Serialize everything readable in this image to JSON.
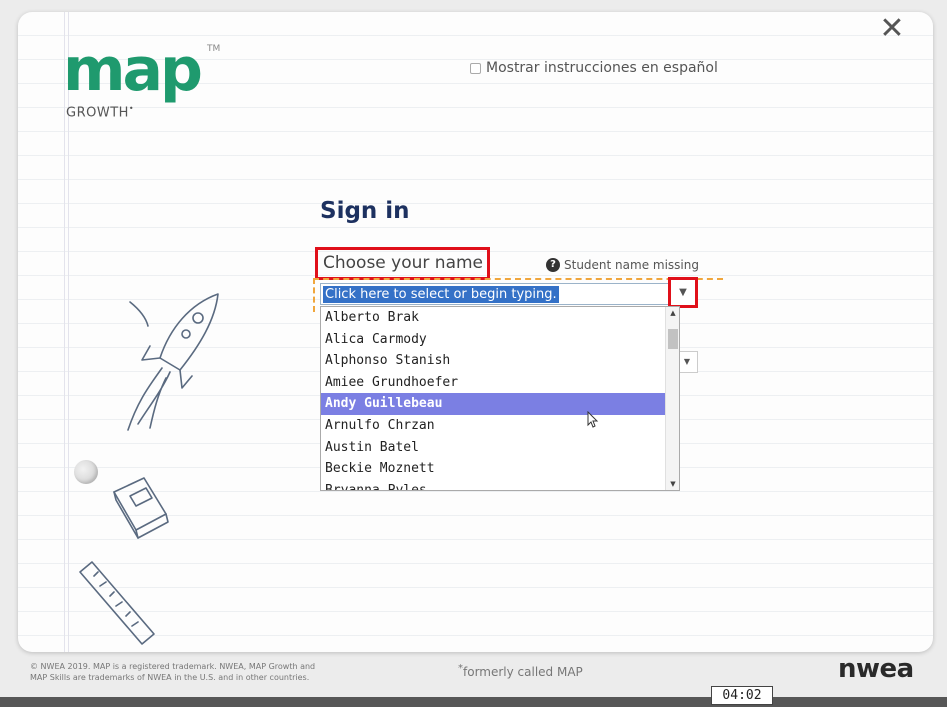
{
  "brand": {
    "logo_text": "map",
    "tm_mark": "TM",
    "logo_subtitle": "GROWTH",
    "logo_subtitle_mark": "•"
  },
  "header": {
    "close_icon": "close-icon",
    "spanish_label": "Mostrar instrucciones en español",
    "spanish_checked": false
  },
  "signin": {
    "title": "Sign in",
    "name_label": "Choose your name",
    "missing_link": "Student name missing",
    "help_icon": "?",
    "combo_value": "Click here to select or begin typing.",
    "dropdown_arrow": "▼"
  },
  "names": [
    "Alberto Brak",
    "Alica Carmody",
    "Alphonso Stanish",
    "Amiee Grundhoefer",
    "Andy Guillebeau",
    "Arnulfo Chrzan",
    "Austin Batel",
    "Beckie Moznett",
    "Bryanna Pyles"
  ],
  "selected_name": "Andy Guillebeau",
  "footer": {
    "legal_line1": "© NWEA 2019. MAP is a registered trademark. NWEA, MAP Growth and",
    "legal_line2": "MAP Skills are trademarks of NWEA in the U.S. and in other countries.",
    "formerly_mark": "*",
    "formerly": "formerly called MAP",
    "nwea_logo": "nwea"
  },
  "timer": "04:02",
  "colors": {
    "title": "#1d3160",
    "highlight": "#7b7fe3",
    "selection": "#3471c7",
    "annotation": "#e0101a",
    "dashed": "#f0a63d"
  }
}
